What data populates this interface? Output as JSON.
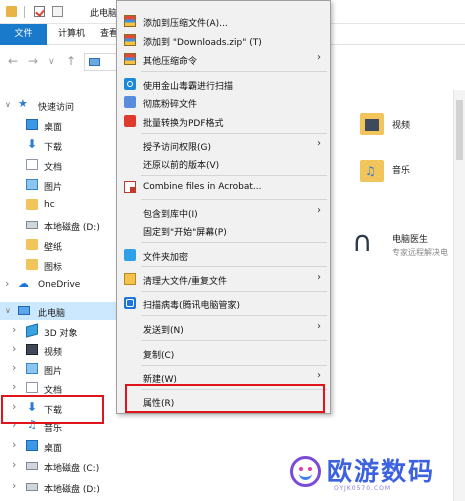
{
  "window": {
    "title": "此电脑"
  },
  "ribbon": {
    "tabs": [
      "文件",
      "计算机",
      "查看"
    ]
  },
  "nav_pane": {
    "items": [
      {
        "label": "快速访问",
        "icon": "star-icon",
        "chevron": "∨"
      },
      {
        "label": "桌面",
        "icon": "desktop-icon"
      },
      {
        "label": "下载",
        "icon": "download-arrow-icon"
      },
      {
        "label": "文档",
        "icon": "document-icon"
      },
      {
        "label": "图片",
        "icon": "pictures-icon"
      },
      {
        "label": "hc",
        "icon": "folder-icon"
      },
      {
        "label": "本地磁盘 (D:)",
        "icon": "drive-icon"
      },
      {
        "label": "壁纸",
        "icon": "folder-icon"
      },
      {
        "label": "图标",
        "icon": "folder-icon"
      },
      {
        "label": "OneDrive",
        "icon": "cloud-icon",
        "chevron": "›"
      },
      {
        "label": "此电脑",
        "icon": "computer-icon",
        "chevron": "∨"
      },
      {
        "label": "3D 对象",
        "icon": "3d-objects-icon",
        "chevron": "›"
      },
      {
        "label": "视频",
        "icon": "video-icon",
        "chevron": "›"
      },
      {
        "label": "图片",
        "icon": "pictures-icon",
        "chevron": "›"
      },
      {
        "label": "文档",
        "icon": "document-icon",
        "chevron": "›"
      },
      {
        "label": "下载",
        "icon": "download-arrow-icon",
        "chevron": "›"
      },
      {
        "label": "音乐",
        "icon": "music-icon",
        "chevron": "›"
      },
      {
        "label": "桌面",
        "icon": "desktop-icon",
        "chevron": "›"
      },
      {
        "label": "本地磁盘 (C:)",
        "icon": "drive-icon",
        "chevron": "›"
      },
      {
        "label": "本地磁盘 (D:)",
        "icon": "drive-icon",
        "chevron": "›"
      }
    ]
  },
  "content": {
    "folders": [
      {
        "label": "视频",
        "icon": "video-folder-icon"
      },
      {
        "label": "音乐",
        "icon": "music-folder-icon"
      }
    ],
    "app": {
      "title": "电脑医生",
      "subtitle": "专家远程解决电",
      "icon": "stethoscope-icon"
    }
  },
  "context_menu": {
    "items": [
      {
        "label": "添加到压缩文件(A)...",
        "icon": "winrar-icon"
      },
      {
        "label": "添加到 \"Downloads.zip\" (T)",
        "icon": "winrar-icon"
      },
      {
        "label": "其他压缩命令",
        "icon": "winrar-icon",
        "submenu": true
      },
      {
        "label": "使用金山毒霸进行扫描",
        "icon": "kingsoft-icon"
      },
      {
        "label": "彻底粉碎文件",
        "icon": "shredder-icon"
      },
      {
        "label": "批量转换为PDF格式",
        "icon": "pdf-icon"
      },
      {
        "label": "授予访问权限(G)",
        "submenu": true
      },
      {
        "label": "还原以前的版本(V)"
      },
      {
        "label": "Combine files in Acrobat...",
        "icon": "acrobat-icon"
      },
      {
        "label": "包含到库中(I)",
        "submenu": true
      },
      {
        "label": "固定到\"开始\"屏幕(P)"
      },
      {
        "label": "文件夹加密",
        "icon": "folder-encrypt-icon"
      },
      {
        "label": "清理大文件/重复文件",
        "icon": "cleaner-icon",
        "submenu": true
      },
      {
        "label": "扫描病毒(腾讯电脑管家)",
        "icon": "tencent-shield-icon"
      },
      {
        "label": "发送到(N)",
        "submenu": true
      },
      {
        "label": "复制(C)"
      },
      {
        "label": "新建(W)",
        "submenu": true
      },
      {
        "label": "属性(R)"
      }
    ],
    "submenu_glyph": "›"
  },
  "watermark": {
    "text": "欧游数码",
    "sub": "OYJK0570.COM"
  },
  "glyphs": {
    "back": "←",
    "forward": "→",
    "star": "★",
    "down_arrow": "⬇",
    "cloud": "☁",
    "music": "♫",
    "steth": "∩"
  },
  "colors": {
    "accent": "#1979ca",
    "highlight": "#e0141b",
    "selected": "#cce8ff"
  }
}
